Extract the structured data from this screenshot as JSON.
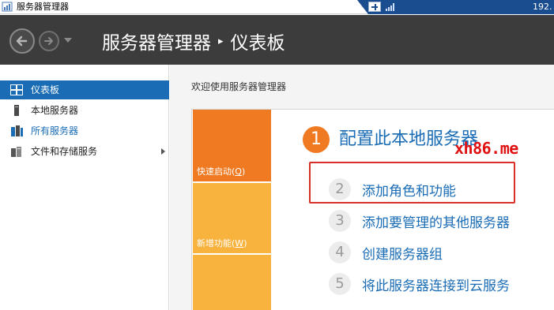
{
  "titlebar": {
    "title": "服务器管理器",
    "ip": "192."
  },
  "header": {
    "breadcrumb_root": "服务器管理器",
    "breadcrumb_separator": "▸",
    "breadcrumb_current": "仪表板"
  },
  "sidebar": {
    "items": [
      {
        "label": "仪表板",
        "icon": "dashboard-icon",
        "state": "selected"
      },
      {
        "label": "本地服务器",
        "icon": "server-icon"
      },
      {
        "label": "所有服务器",
        "icon": "servers-icon"
      },
      {
        "label": "文件和存储服务",
        "icon": "storage-icon",
        "expandable": true
      }
    ]
  },
  "main": {
    "welcome": "欢迎使用服务器管理器",
    "tiles": [
      {
        "label": "快速启动(",
        "accel": "Q",
        "suffix": ")"
      },
      {
        "label": "新增功能(",
        "accel": "W",
        "suffix": ")"
      }
    ],
    "steps": [
      {
        "num": "1",
        "text": "配置此本地服务器"
      },
      {
        "num": "2",
        "text": "添加角色和功能"
      },
      {
        "num": "3",
        "text": "添加要管理的其他服务器"
      },
      {
        "num": "4",
        "text": "创建服务器组"
      },
      {
        "num": "5",
        "text": "将此服务器连接到云服务"
      }
    ]
  },
  "watermark": "xh86.me",
  "colors": {
    "header_bg": "#3c3c3c",
    "selected_bg": "#1a6cb5",
    "link": "#1a6cb5",
    "tile_orange": "#f07a22",
    "tile_amber": "#f8b23e",
    "highlight": "#d9302a"
  }
}
